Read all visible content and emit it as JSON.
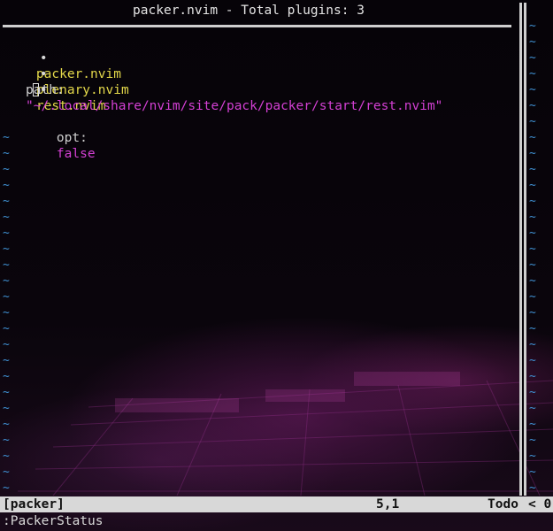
{
  "window": {
    "title": "packer.nvim - Total plugins: 3"
  },
  "plugins": [
    {
      "bullet": "•",
      "name": "packer.nvim"
    },
    {
      "bullet": "•",
      "name": "plenary.nvim"
    },
    {
      "bullet": "•",
      "name": "rest.nvim"
    }
  ],
  "details": {
    "path_key": "path:",
    "path_value": "\"~/.local/share/nvim/site/pack/packer/start/rest.nvim\"",
    "opt_key": "opt:",
    "opt_value": "false"
  },
  "filler": {
    "tilde": "~"
  },
  "statusline": {
    "buffer_name": "[packer]",
    "position": "5,1",
    "scroll": "Todo",
    "right_window": "< 0"
  },
  "cmdline": {
    "text": ":PackerStatus"
  },
  "colors": {
    "plugin_name": "#e3d84a",
    "string_value": "#d340d3",
    "filler_tilde": "#3f8fd0",
    "statusline_bg": "#d8d8d8"
  }
}
